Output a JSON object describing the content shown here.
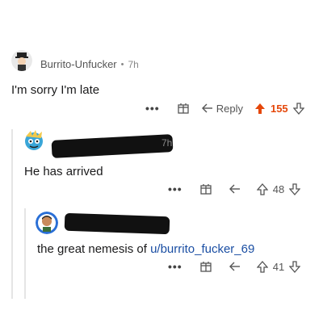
{
  "comments": [
    {
      "username": "Burrito-Unfucker",
      "separator": "•",
      "time": "7h",
      "text": "I'm sorry I'm late",
      "actions": {
        "more": "•••",
        "reply": "Reply",
        "score": "155"
      }
    },
    {
      "time_fragment": "7h",
      "text": "He has arrived",
      "actions": {
        "more": "•••",
        "score": "48"
      }
    },
    {
      "text_prefix": "the great nemesis of ",
      "text_link": "u/burrito_fucker_69",
      "actions": {
        "more": "•••",
        "score": "41"
      }
    }
  ],
  "colors": {
    "upvote_active": "#e5470a",
    "link": "#1a4ea3",
    "thread_line": "#e5e5e5"
  }
}
